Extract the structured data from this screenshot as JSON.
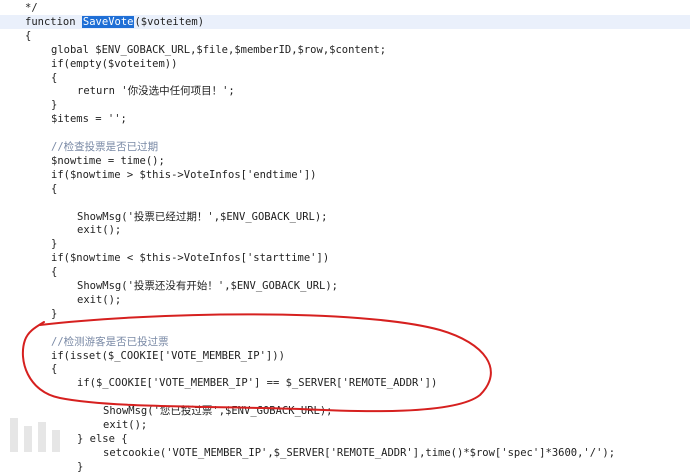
{
  "code_view": {
    "lines": [
      {
        "indent": 0,
        "text": "*/",
        "kind": "code"
      },
      {
        "indent": 0,
        "text": "function ",
        "kind": "fn"
      },
      {
        "indent": 0,
        "text": "{",
        "kind": "code"
      },
      {
        "indent": 1,
        "text": "global $ENV_GOBACK_URL,$file,$memberID,$row,$content;",
        "kind": "code"
      },
      {
        "indent": 1,
        "text": "if(empty($voteitem))",
        "kind": "code"
      },
      {
        "indent": 1,
        "text": "{",
        "kind": "code"
      },
      {
        "indent": 2,
        "text": "return '你没选中任何项目！';",
        "kind": "code"
      },
      {
        "indent": 1,
        "text": "}",
        "kind": "code"
      },
      {
        "indent": 1,
        "text": "$items = '';",
        "kind": "code"
      },
      {
        "indent": 0,
        "text": "",
        "kind": "code"
      },
      {
        "indent": 1,
        "text": "//检查投票是否已过期",
        "kind": "comment"
      },
      {
        "indent": 1,
        "text": "$nowtime = time();",
        "kind": "code"
      },
      {
        "indent": 1,
        "text": "if($nowtime > $this->VoteInfos['endtime'])",
        "kind": "code"
      },
      {
        "indent": 1,
        "text": "{",
        "kind": "code"
      },
      {
        "indent": 0,
        "text": "",
        "kind": "code"
      },
      {
        "indent": 2,
        "text": "ShowMsg('投票已经过期！',$ENV_GOBACK_URL);",
        "kind": "code"
      },
      {
        "indent": 2,
        "text": "exit();",
        "kind": "code"
      },
      {
        "indent": 1,
        "text": "}",
        "kind": "code"
      },
      {
        "indent": 1,
        "text": "if($nowtime < $this->VoteInfos['starttime'])",
        "kind": "code"
      },
      {
        "indent": 1,
        "text": "{",
        "kind": "code"
      },
      {
        "indent": 2,
        "text": "ShowMsg('投票还没有开始！',$ENV_GOBACK_URL);",
        "kind": "code"
      },
      {
        "indent": 2,
        "text": "exit();",
        "kind": "code"
      },
      {
        "indent": 1,
        "text": "}",
        "kind": "code"
      },
      {
        "indent": 0,
        "text": "",
        "kind": "code"
      },
      {
        "indent": 1,
        "text": "//检测游客是否已投过票",
        "kind": "comment"
      },
      {
        "indent": 1,
        "text": "if(isset($_COOKIE['VOTE_MEMBER_IP']))",
        "kind": "code"
      },
      {
        "indent": 1,
        "text": "{",
        "kind": "code"
      },
      {
        "indent": 2,
        "text": "if($_COOKIE['VOTE_MEMBER_IP'] == $_SERVER['REMOTE_ADDR'])",
        "kind": "code"
      },
      {
        "indent": 0,
        "text": "",
        "kind": "code"
      },
      {
        "indent": 3,
        "text": "ShowMsg('您已投过票',$ENV_GOBACK_URL);",
        "kind": "code"
      },
      {
        "indent": 3,
        "text": "exit();",
        "kind": "code"
      },
      {
        "indent": 2,
        "text": "} else {",
        "kind": "code"
      },
      {
        "indent": 3,
        "text": "setcookie('VOTE_MEMBER_IP',$_SERVER['REMOTE_ADDR'],time()*$row['spec']*3600,'/');",
        "kind": "code"
      },
      {
        "indent": 2,
        "text": "}",
        "kind": "code"
      }
    ],
    "function_name": "SaveVote",
    "function_params": "($voteitem)"
  },
  "colors": {
    "text": "#1f1f1f",
    "comment": "#7a8aa6",
    "selection": "#1f6fd6",
    "current_line": "#eaf0fb",
    "annotation": "#d6201f"
  }
}
